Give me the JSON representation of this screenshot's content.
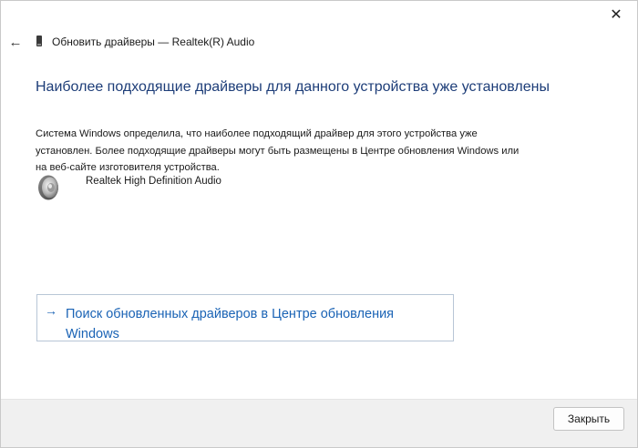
{
  "window": {
    "close_glyph": "✕"
  },
  "titlebar": {
    "back_glyph": "←",
    "title": "Обновить драйверы — Realtek(R) Audio"
  },
  "main": {
    "heading": "Наиболее подходящие драйверы для данного устройства уже установлены",
    "description": "Система Windows определила, что наиболее подходящий драйвер для этого устройства уже установлен. Более подходящие драйверы могут быть размещены в Центре обновления Windows или на веб-сайте изготовителя устройства.",
    "device_icon": "speaker-icon",
    "device_name": "Realtek High Definition Audio",
    "search_link": {
      "arrow_glyph": "→",
      "label": "Поиск обновленных драйверов в Центре обновления Windows"
    }
  },
  "footer": {
    "close_label": "Закрыть"
  },
  "colors": {
    "heading": "#1d3d78",
    "link": "#1a63b5",
    "footer_bg": "#f0f0f0"
  }
}
